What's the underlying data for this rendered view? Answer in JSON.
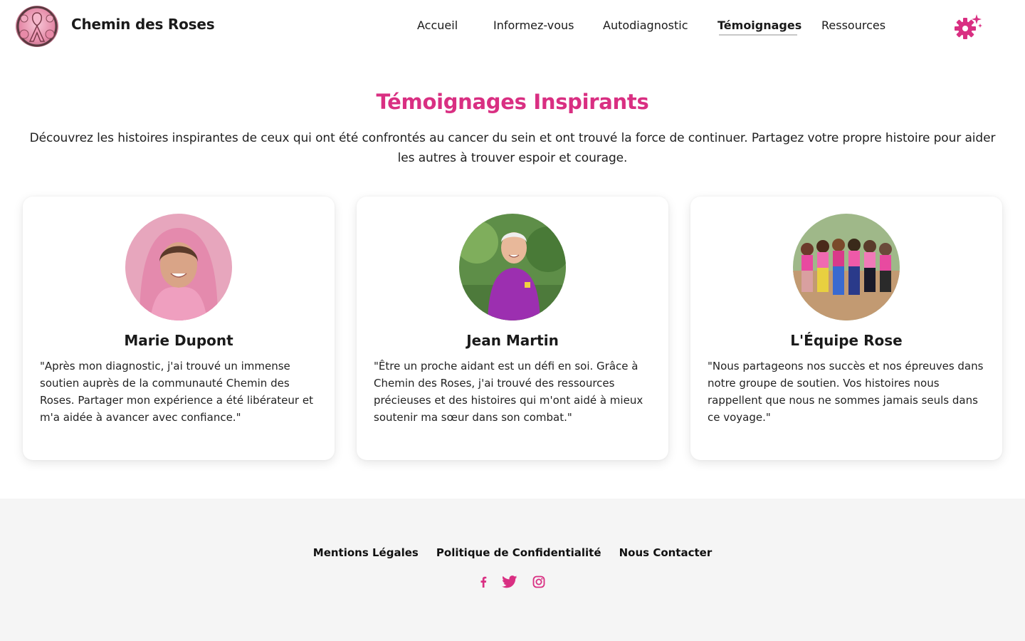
{
  "header": {
    "brand": "Chemin des Roses",
    "nav": [
      {
        "label": "Accueil"
      },
      {
        "label": "Informez-vous"
      },
      {
        "label": "Autodiagnostic"
      },
      {
        "label": "Témoignages"
      },
      {
        "label": "Ressources"
      }
    ],
    "active_nav": "Témoignages",
    "settings_icon": "gear-sparkle-icon"
  },
  "main": {
    "title": "Témoignages Inspirants",
    "intro": "Découvrez les histoires inspirantes de ceux qui ont été confrontés au cancer du sein et ont trouvé la force de continuer. Partagez votre propre histoire pour aider les autres à trouver espoir et courage.",
    "cards": [
      {
        "name": "Marie Dupont",
        "quote": "\"Après mon diagnostic, j'ai trouvé un immense soutien auprès de la communauté Chemin des Roses. Partager mon expérience a été libérateur et m'a aidée à avancer avec confiance.\""
      },
      {
        "name": "Jean Martin",
        "quote": "\"Être un proche aidant est un défi en soi. Grâce à Chemin des Roses, j'ai trouvé des ressources précieuses et des histoires qui m'ont aidé à mieux soutenir ma sœur dans son combat.\""
      },
      {
        "name": "L'Équipe Rose",
        "quote": "\"Nous partageons nos succès et nos épreuves dans notre groupe de soutien. Vos histoires nous rappellent que nous ne sommes jamais seuls dans ce voyage.\""
      }
    ]
  },
  "footer": {
    "links": [
      {
        "label": "Mentions Légales"
      },
      {
        "label": "Politique de Confidentialité"
      },
      {
        "label": "Nous Contacter"
      }
    ],
    "socials": [
      "facebook-icon",
      "twitter-icon",
      "instagram-icon"
    ]
  },
  "colors": {
    "accent": "#d92f82",
    "footer_bg": "#f5f5f5"
  }
}
